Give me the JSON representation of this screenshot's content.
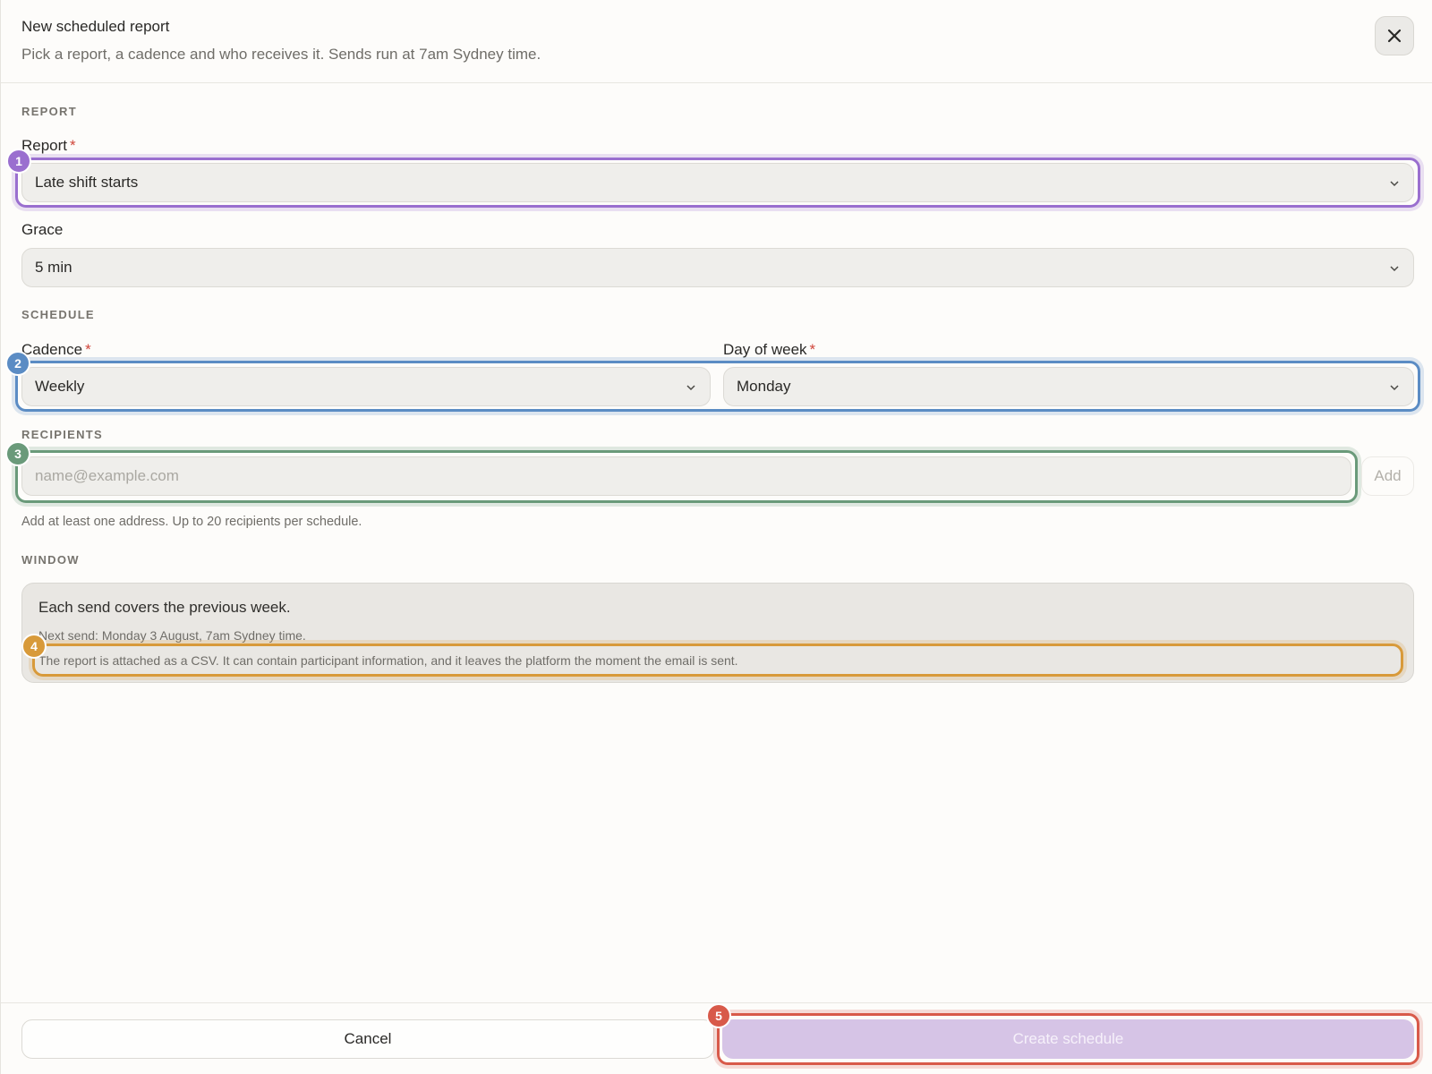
{
  "header": {
    "title": "New scheduled report",
    "subtitle": "Pick a report, a cadence and who receives it. Sends run at 7am Sydney time."
  },
  "report_section": {
    "label": "REPORT",
    "report_label": "Report",
    "report_value": "Late shift starts",
    "grace_label": "Grace",
    "grace_value": "5 min"
  },
  "schedule_section": {
    "label": "SCHEDULE",
    "cadence_label": "Cadence",
    "cadence_value": "Weekly",
    "day_label": "Day of week",
    "day_value": "Monday"
  },
  "recipients_section": {
    "label": "RECIPIENTS",
    "placeholder": "name@example.com",
    "add_label": "Add",
    "helper": "Add at least one address. Up to 20 recipients per schedule."
  },
  "window_section": {
    "label": "WINDOW",
    "line1": "Each send covers the previous week.",
    "line2": "Next send: Monday 3 August, 7am Sydney time.",
    "line3": "The report is attached as a CSV. It can contain participant information, and it leaves the platform the moment the email is sent."
  },
  "footer": {
    "cancel_label": "Cancel",
    "create_label": "Create schedule"
  },
  "annotations": [
    {
      "number": "1",
      "color": "#9a6fcf"
    },
    {
      "number": "2",
      "color": "#5b8cc4"
    },
    {
      "number": "3",
      "color": "#6a9a7a"
    },
    {
      "number": "4",
      "color": "#d89a3a"
    },
    {
      "number": "5",
      "color": "#d85a4a"
    }
  ],
  "icons": {
    "close": "close-icon",
    "chevron": "chevron-down-icon"
  }
}
